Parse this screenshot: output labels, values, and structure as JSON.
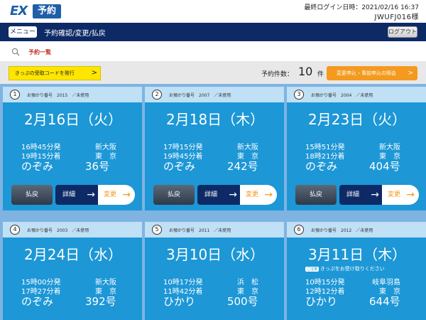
{
  "header": {
    "logo_ex": "EX",
    "logo_yoyaku": "予約",
    "last_login": "最終ログイン日時：2021/02/16 16:37",
    "user_id": "JWUFJ016様"
  },
  "nav": {
    "menu_label": "メニュー",
    "title": "予約確認/変更/払戻",
    "logout_label": "ログアウト"
  },
  "breadcrumb": {
    "label": "予約一覧"
  },
  "actions": {
    "issue_label": "きっぷの受取コードを発行",
    "issue_arrow": ">",
    "count_label": "予約件数：",
    "count_value": "10",
    "count_unit": "件",
    "apply_label": "変更申込・事前申込の照会",
    "apply_arrow": ">"
  },
  "buttons": {
    "refund": "払戻",
    "detail": "詳細",
    "change": "変更",
    "arrow": "→"
  },
  "cards": [
    {
      "num": "1",
      "meta": "お預かり番号　2015　／未使用",
      "date": "2月16日（火）",
      "dep_time": "16時45分発",
      "arr_time": "19時15分着",
      "dep_stn": "新大阪",
      "arr_stn": "東　京",
      "train": "のぞみ",
      "train_no": "36号",
      "notice": ""
    },
    {
      "num": "2",
      "meta": "お預かり番号　2007　／未使用",
      "date": "2月18日（木）",
      "dep_time": "17時15分発",
      "arr_time": "19時45分着",
      "dep_stn": "新大阪",
      "arr_stn": "東　京",
      "train": "のぞみ",
      "train_no": "242号",
      "notice": ""
    },
    {
      "num": "3",
      "meta": "お預かり番号　2004　／未使用",
      "date": "2月23日（火）",
      "dep_time": "15時51分発",
      "arr_time": "18時21分着",
      "dep_stn": "新大阪",
      "arr_stn": "東　京",
      "train": "のぞみ",
      "train_no": "404号",
      "notice": ""
    },
    {
      "num": "4",
      "meta": "お預かり番号　2003　／未使用",
      "date": "2月24日（水）",
      "dep_time": "15時00分発",
      "arr_time": "17時27分着",
      "dep_stn": "新大阪",
      "arr_stn": "東　京",
      "train": "のぞみ",
      "train_no": "392号",
      "notice": ""
    },
    {
      "num": "5",
      "meta": "お預かり番号　2011　／未使用",
      "date": "3月10日（水）",
      "dep_time": "10時17分発",
      "arr_time": "11時42分着",
      "dep_stn": "浜　松",
      "arr_stn": "東　京",
      "train": "ひかり",
      "train_no": "500号",
      "notice": ""
    },
    {
      "num": "6",
      "meta": "お預かり番号　2012　／未使用",
      "date": "3月11日（木）",
      "dep_time": "10時15分発",
      "arr_time": "12時12分着",
      "dep_stn": "岐阜羽島",
      "arr_stn": "東　京",
      "train": "ひかり",
      "train_no": "644号",
      "notice": "きっぷをお受け取りください",
      "notice_tag": "ご注意"
    }
  ]
}
